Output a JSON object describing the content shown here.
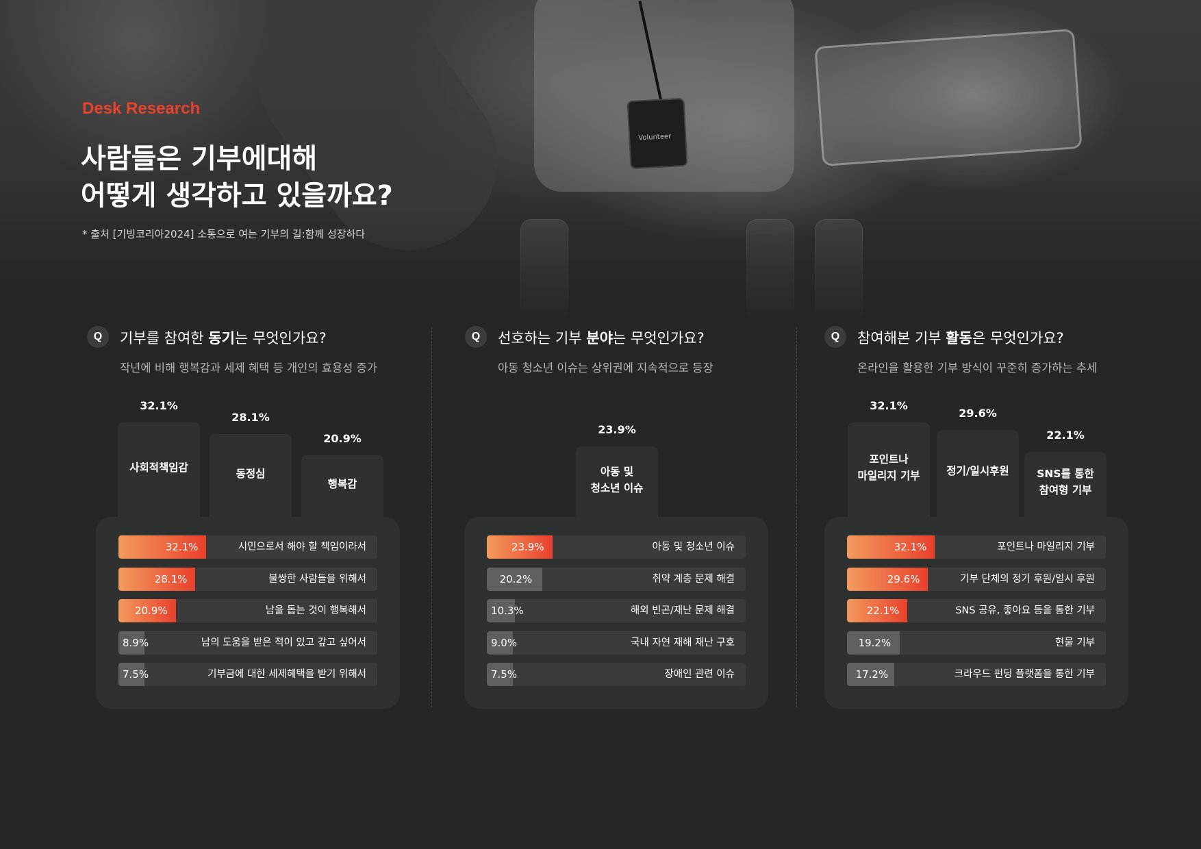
{
  "header": {
    "eyebrow": "Desk Research",
    "title_line1": "사람들은 기부에대해",
    "title_line2": "어떻게 생각하고 있을까요?",
    "source": "* 출처 [기빙코리아2024] 소통으로 여는 기부의 길:함께 성장하다",
    "photo_badge": "Volunteer"
  },
  "colors": {
    "accent": "#e8412c",
    "accent_light": "#f29a5e",
    "muted_bar": "#5f5f5f",
    "panel": "#2f3030",
    "background": "#262626"
  },
  "questions": [
    {
      "icon": "Q",
      "title_pre": "기부를 참여한 ",
      "title_bold": "동기",
      "title_post": "는 무엇인가요?",
      "subtitle": "작년에 비해 행복감과 세제 혜택 등 개인의 효용성 증가"
    },
    {
      "icon": "Q",
      "title_pre": "선호하는 기부 ",
      "title_bold": "분야",
      "title_post": "는 무엇인가요?",
      "subtitle": "아동 청소년 이슈는 상위권에 지속적으로 등장"
    },
    {
      "icon": "Q",
      "title_pre": "참여해본 기부 ",
      "title_bold": "활동",
      "title_post": "은 무엇인가요?",
      "subtitle": "온라인을 활용한 기부 방식이 꾸준히 증가하는 추세"
    }
  ],
  "chart_data": [
    {
      "type": "bar",
      "title": "기부를 참여한 동기는 무엇인가요?",
      "podium": [
        {
          "label": "사회적책임감",
          "value": 32.1,
          "value_label": "32.1%"
        },
        {
          "label": "동정심",
          "value": 28.1,
          "value_label": "28.1%"
        },
        {
          "label": "행복감",
          "value": 20.9,
          "value_label": "20.9%"
        }
      ],
      "categories": [
        "시민으로서 해야 할 책임이라서",
        "불쌍한 사람들을 위해서",
        "남을 돕는 것이 행복해서",
        "남의 도움을 받은 적이 있고 갚고 싶어서",
        "기부금에 대한 세제혜택을 받기 위해서"
      ],
      "values": [
        32.1,
        28.1,
        20.9,
        8.9,
        7.5
      ],
      "value_labels": [
        "32.1%",
        "28.1%",
        "20.9%",
        "8.9%",
        "7.5%"
      ],
      "highlight": [
        true,
        true,
        true,
        false,
        false
      ]
    },
    {
      "type": "bar",
      "title": "선호하는 기부 분야는 무엇인가요?",
      "podium": [
        {
          "label": "아동 및\n청소년  이슈",
          "value": 23.9,
          "value_label": "23.9%"
        }
      ],
      "categories": [
        "아동 및 청소년 이슈",
        "취약 계층 문제 해결",
        "해외 빈곤/재난 문제 해결",
        "국내 자연 재해 재난 구호",
        "장애인 관련 이슈"
      ],
      "values": [
        23.9,
        20.2,
        10.3,
        9.0,
        7.5
      ],
      "value_labels": [
        "23.9%",
        "20.2%",
        "10.3%",
        "9.0%",
        "7.5%"
      ],
      "highlight": [
        true,
        false,
        false,
        false,
        false
      ]
    },
    {
      "type": "bar",
      "title": "참여해본 기부 활동은 무엇인가요?",
      "podium": [
        {
          "label": "포인트나\n마일리지 기부",
          "value": 32.1,
          "value_label": "32.1%"
        },
        {
          "label": "정기/일시후원",
          "value": 29.6,
          "value_label": "29.6%"
        },
        {
          "label": "SNS를 통한\n참여형 기부",
          "value": 22.1,
          "value_label": "22.1%"
        }
      ],
      "categories": [
        "포인트나 마일리지 기부",
        "기부 단체의 정기 후원/일시 후원",
        "SNS 공유, 좋아요 등을 통한 기부",
        "현물 기부",
        "크라우드 펀딩 플랫폼을 통한 기부"
      ],
      "values": [
        32.1,
        29.6,
        22.1,
        19.2,
        17.2
      ],
      "value_labels": [
        "32.1%",
        "29.6%",
        "22.1%",
        "19.2%",
        "17.2%"
      ],
      "highlight": [
        true,
        true,
        true,
        false,
        false
      ]
    }
  ]
}
